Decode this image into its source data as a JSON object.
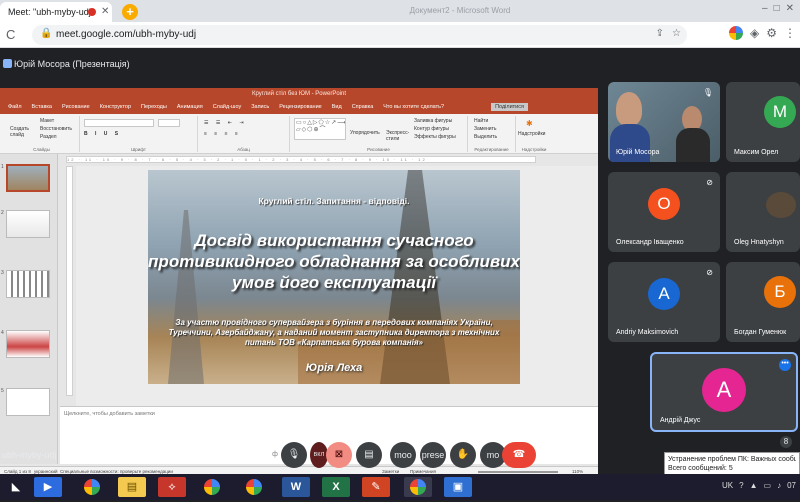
{
  "browser": {
    "tab_title": "Meet: \"ubh-myby-udj\"",
    "tab_close": "✕",
    "new_tab": "+",
    "window_title": "Документ2 - Microsoft Word",
    "window_buttons": [
      "–",
      "□",
      "✕"
    ],
    "back": "←",
    "reload": "C",
    "url": "meet.google.com/ubh-myby-udj",
    "omni_icons": [
      "⇪",
      "☆"
    ],
    "profile_icons": [
      "G",
      "◈",
      "⚙",
      "⋮"
    ]
  },
  "meet": {
    "presenter": "Юрій Мосора (Презентація)",
    "meeting_code": "ubh-myby-udj",
    "participants": [
      {
        "name": "Юрій Мосора",
        "initial": "",
        "color": "#5f7a8a",
        "muted": false,
        "video": true
      },
      {
        "name": "Максим Орел",
        "initial": "M",
        "color": "#34a853",
        "muted": false,
        "video": false
      },
      {
        "name": "Олександр Іващенко",
        "initial": "О",
        "color": "#f4511e",
        "muted": true,
        "video": false
      },
      {
        "name": "Oleg Hnatyshyn",
        "initial": "",
        "color": "#5a4a3a",
        "muted": false,
        "video": true
      },
      {
        "name": "Andriy Maksimovich",
        "initial": "A",
        "color": "#1967d2",
        "muted": true,
        "video": false
      },
      {
        "name": "Богдан Гуменюк",
        "initial": "Б",
        "color": "#e8710a",
        "muted": false,
        "video": false
      },
      {
        "name": "Андрій Джус",
        "initial": "А",
        "color": "#e52592",
        "muted": false,
        "video": false
      }
    ],
    "more_badge": "•••",
    "controls": {
      "mic_label": "ф",
      "cam_label": "вкл",
      "captions_label": "▤",
      "present_label": "moo",
      "present2_label": "prese",
      "hand_label": "✋",
      "more_label": "mo",
      "end_label": "☎",
      "count": "8"
    },
    "toast": {
      "line1": "Устранение проблем ПК: Важных сообщений",
      "line2": "Всего сообщений: 5"
    }
  },
  "ppt": {
    "title_bar": "Круглий стіл без ЮМ - PowerPoint",
    "share_label": "Поділитися",
    "tabs": [
      "Файл",
      "Вставка",
      "Рисование",
      "Конструктор",
      "Переходы",
      "Анимация",
      "Слайд-шоу",
      "Запись",
      "Рецензирование",
      "Вид",
      "Справка",
      "Что вы хотите сделать?"
    ],
    "ribbon": {
      "create": "Создать\nслайд",
      "layout": "Макет",
      "reset": "Восстановить",
      "section": "Раздел",
      "group_slides": "Слайды",
      "group_font": "Шрифт",
      "group_para": "Абзац",
      "group_draw": "Рисование",
      "group_edit": "Редактирование",
      "arrange": "Упорядочить",
      "quick_styles": "Экспресс-\nстили",
      "fill": "Заливка фигуры",
      "outline": "Контур фигуры",
      "effects": "Эффекты фигуры",
      "find": "Найти",
      "replace": "Заменить",
      "select": "Выделить",
      "addins": "Надстройки",
      "group_addins": "Надстройки",
      "ruler": "12 · 11 · 10 · 9 · 8 · 7 · 6 · 5 · 4 · 3 · 2 · 1 · 0 · 1 · 2 · 3 · 4 · 5 · 6 · 7 · 8 · 9 · 10 · 11 · 12"
    },
    "slide": {
      "subtitle": "Круглий стіл. Запитання - відповіді.",
      "title": "Досвід використання сучасного противикидного обладнання за особливих умов його експлуатації",
      "body": "За участю провідного супервайзера з буріння в передових компаніях України, Туреччини, Азербайджану, а наданий момент заступника директора з технічних питань ТОВ «Карпатська бурова компанія»",
      "name": "Юрія Леха"
    },
    "thumb_numbers": [
      "1",
      "2",
      "3",
      "4",
      "5"
    ],
    "notes_placeholder": "Щелкните, чтобы добавить заметки",
    "status": {
      "slide": "Слайд 1 из 8",
      "lang": "украинский",
      "access": "Специальные возможности: проверьте рекомендации",
      "notes": "Заметки",
      "comments": "Примечания",
      "zoom": "110%"
    }
  },
  "taskbar": {
    "lang": "UK",
    "time": "07"
  }
}
